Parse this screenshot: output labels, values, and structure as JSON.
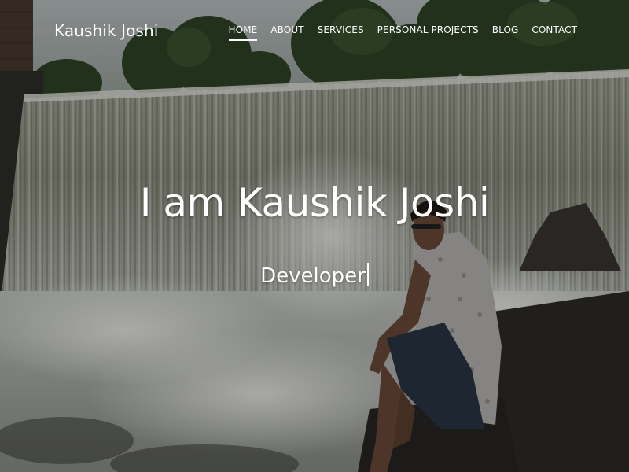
{
  "brand": {
    "name": "Kaushik Joshi"
  },
  "nav": {
    "items": [
      {
        "label": "HOME",
        "active": true
      },
      {
        "label": "ABOUT",
        "active": false
      },
      {
        "label": "SERVICES",
        "active": false
      },
      {
        "label": "PERSONAL PROJECTS",
        "active": false
      },
      {
        "label": "BLOG",
        "active": false
      },
      {
        "label": "CONTACT",
        "active": false
      }
    ]
  },
  "hero": {
    "title": "I am Kaushik Joshi",
    "typed_text": "Developer",
    "background": "waterfall-photo"
  },
  "colors": {
    "text": "#ffffff",
    "sky": "#c9d0cf",
    "foliage": "#2f4a26",
    "water": "#cfd3cc",
    "rock": "#2b2b28"
  }
}
